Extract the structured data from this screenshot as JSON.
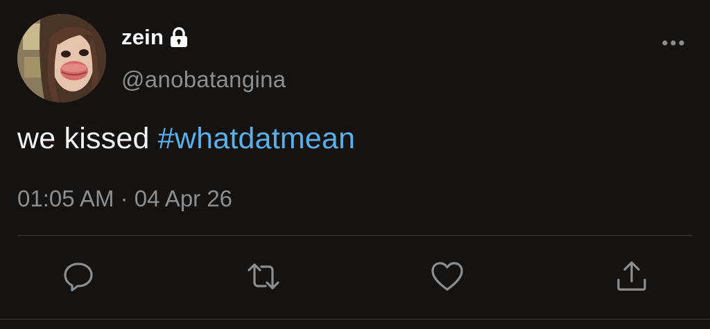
{
  "user": {
    "display_name": "zein",
    "handle": "@anobatangina",
    "avatar_icon": "profile-photo",
    "protected_icon": "lock-icon"
  },
  "tweet": {
    "text_plain": "we kissed ",
    "hashtag": "#whatdatmean",
    "timestamp": "01:05 AM · 04 Apr 26"
  },
  "actions": {
    "reply_icon": "reply-icon",
    "retweet_icon": "retweet-icon",
    "like_icon": "heart-icon",
    "share_icon": "share-icon",
    "more_icon": "more-icon"
  },
  "colors": {
    "background": "#16120f",
    "text": "#f2f2f2",
    "secondary_text": "#8e8e8e",
    "link": "#5ab0ec",
    "icon": "#8e8e8e"
  }
}
